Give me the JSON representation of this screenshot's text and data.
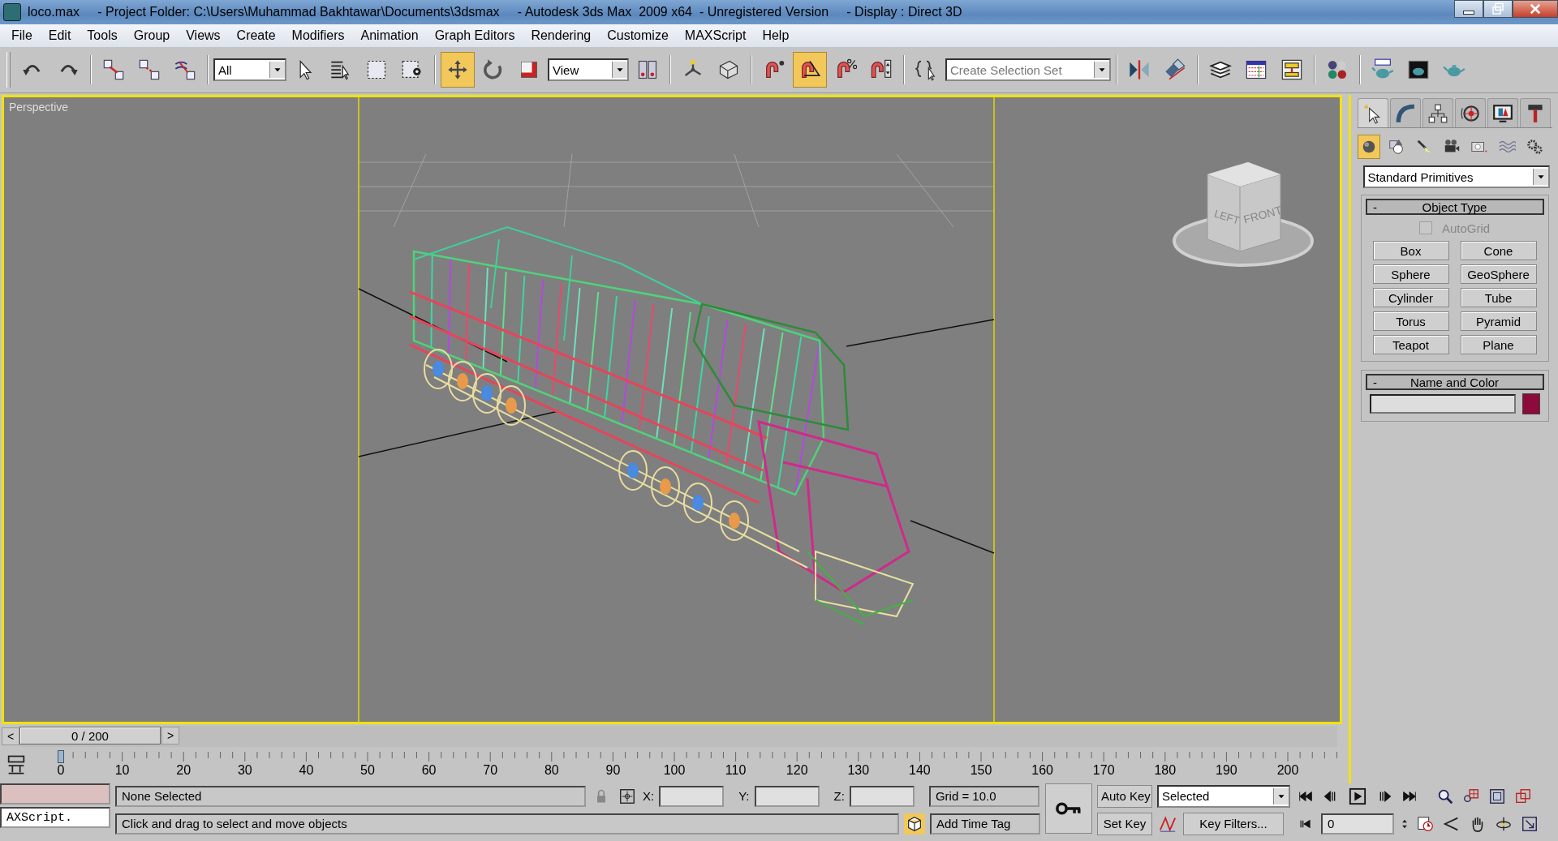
{
  "window": {
    "title": "loco.max     - Project Folder: C:\\Users\\Muhammad Bakhtawar\\Documents\\3dsmax     - Autodesk 3ds Max  2009 x64  - Unregistered Version     - Display : Direct 3D"
  },
  "menu": [
    "File",
    "Edit",
    "Tools",
    "Group",
    "Views",
    "Create",
    "Modifiers",
    "Animation",
    "Graph Editors",
    "Rendering",
    "Customize",
    "MAXScript",
    "Help"
  ],
  "toolbar": [
    [
      {
        "kind": "tool",
        "selected": false
      },
      {
        "kind": "tool",
        "selected": false
      }
    ],
    [
      {
        "kind": "tool",
        "selected": false
      },
      {
        "kind": "tool",
        "selected": false
      },
      {
        "kind": "tool",
        "selected": false
      }
    ],
    [
      {
        "kind": "dropdown",
        "value": "All"
      },
      {
        "kind": "tool",
        "selected": false
      },
      {
        "kind": "tool",
        "selected": false
      },
      {
        "kind": "tool",
        "selected": false
      },
      {
        "kind": "tool",
        "selected": false
      }
    ],
    [
      {
        "kind": "tool",
        "selected": true
      },
      {
        "kind": "tool",
        "selected": false
      },
      {
        "kind": "tool",
        "selected": false
      },
      {
        "kind": "dropdown",
        "value": "View"
      },
      {
        "kind": "tool",
        "selected": false
      }
    ],
    [
      {
        "kind": "tool",
        "selected": false
      },
      {
        "kind": "tool",
        "selected": false
      }
    ],
    [
      {
        "kind": "tool",
        "selected": false
      },
      {
        "kind": "tool",
        "selected": true
      },
      {
        "kind": "tool",
        "selected": false
      },
      {
        "kind": "tool",
        "selected": false
      }
    ],
    [
      {
        "kind": "tool",
        "selected": false
      },
      {
        "kind": "dropdown",
        "placeholder": "Create Selection Set"
      }
    ],
    [
      {
        "kind": "tool",
        "selected": false
      },
      {
        "kind": "tool",
        "selected": false
      }
    ],
    [
      {
        "kind": "tool",
        "selected": false
      },
      {
        "kind": "tool",
        "selected": false
      },
      {
        "kind": "tool",
        "selected": false
      }
    ],
    [
      {
        "kind": "tool",
        "selected": false
      }
    ],
    [
      {
        "kind": "tool",
        "selected": false
      },
      {
        "kind": "tool",
        "selected": false
      },
      {
        "kind": "tool",
        "selected": false
      }
    ]
  ],
  "viewport": {
    "label": "Perspective",
    "viewcube_faces": [
      "LEFT",
      "FRONT"
    ]
  },
  "command_panel": {
    "tabs": [
      {
        "selected": true
      },
      {
        "selected": false
      },
      {
        "selected": false
      },
      {
        "selected": false
      },
      {
        "selected": false
      },
      {
        "selected": false
      }
    ],
    "categories": [
      {
        "selected": true
      },
      {
        "selected": false
      },
      {
        "selected": false
      },
      {
        "selected": false
      },
      {
        "selected": false
      },
      {
        "selected": false
      },
      {
        "selected": false
      }
    ],
    "dropdown": "Standard Primitives",
    "object_type": {
      "collapse": "-",
      "title": "Object Type",
      "autogrid": {
        "label": "AutoGrid",
        "checked": false,
        "disabled": true
      },
      "buttons": [
        "Box",
        "Cone",
        "Sphere",
        "GeoSphere",
        "Cylinder",
        "Tube",
        "Torus",
        "Pyramid",
        "Teapot",
        "Plane"
      ]
    },
    "name_and_color": {
      "collapse": "-",
      "title": "Name and Color",
      "color": "#8c0a3c"
    }
  },
  "time_slider": {
    "prev": "<",
    "position": "0 / 200",
    "next": ">",
    "level": 0
  },
  "track_bar": {
    "labels": [
      "0",
      "10",
      "20",
      "30",
      "40",
      "50",
      "60",
      "70",
      "80",
      "90",
      "100",
      "110",
      "120",
      "130",
      "140",
      "150",
      "160",
      "170",
      "180",
      "190",
      "200"
    ]
  },
  "status": {
    "listener_input": "AXScript.",
    "selection": "None Selected",
    "prompt": "Click and drag to select and move objects",
    "x_label": "X:",
    "y_label": "Y:",
    "z_label": "Z:",
    "grid": "Grid = 10.0",
    "time_tag": "Add Time Tag",
    "auto_key": "Auto Key",
    "set_key": "Set Key",
    "key_mode": "Selected",
    "key_filters": "Key Filters...",
    "frame": "0"
  }
}
